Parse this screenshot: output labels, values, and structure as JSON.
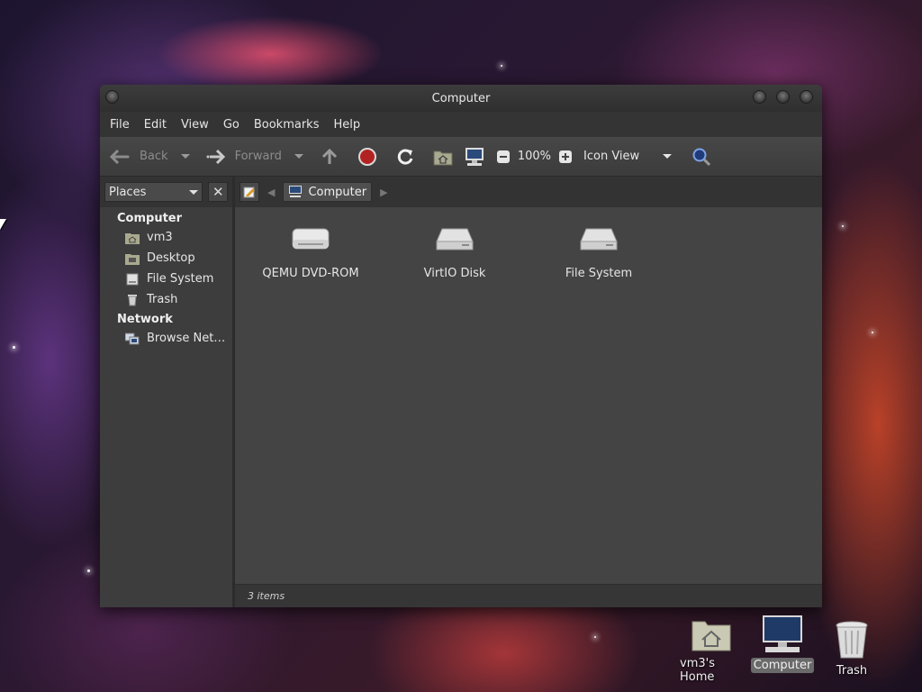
{
  "window": {
    "title": "Computer"
  },
  "menubar": {
    "items": [
      "File",
      "Edit",
      "View",
      "Go",
      "Bookmarks",
      "Help"
    ]
  },
  "toolbar": {
    "back_label": "Back",
    "forward_label": "Forward",
    "zoom_level": "100%",
    "view_mode": "Icon View"
  },
  "sidebar": {
    "selector": "Places",
    "close_symbol": "✕",
    "sections": [
      {
        "title": "Computer",
        "items": [
          {
            "label": "vm3",
            "icon": "home-folder-icon"
          },
          {
            "label": "Desktop",
            "icon": "desktop-folder-icon"
          },
          {
            "label": "File System",
            "icon": "filesystem-icon"
          },
          {
            "label": "Trash",
            "icon": "trash-icon"
          }
        ]
      },
      {
        "title": "Network",
        "items": [
          {
            "label": "Browse Net…",
            "icon": "network-icon"
          }
        ]
      }
    ]
  },
  "pathbar": {
    "crumb": "Computer"
  },
  "files": [
    {
      "label": "QEMU DVD-ROM",
      "icon": "optical-drive-icon"
    },
    {
      "label": "VirtIO Disk",
      "icon": "hard-disk-icon"
    },
    {
      "label": "File System",
      "icon": "hard-disk-icon"
    }
  ],
  "status": {
    "text": "3 items"
  },
  "desktop": {
    "icons": [
      {
        "label": "vm3's Home",
        "icon": "home-folder-icon"
      },
      {
        "label": "Computer",
        "icon": "computer-icon",
        "selected": true
      },
      {
        "label": "Trash",
        "icon": "trash-icon"
      }
    ]
  },
  "colors": {
    "window_bg": "#3a3a3a",
    "content_bg": "#444444",
    "stop_red": "#b22222",
    "search_blue": "#3a63b8"
  }
}
